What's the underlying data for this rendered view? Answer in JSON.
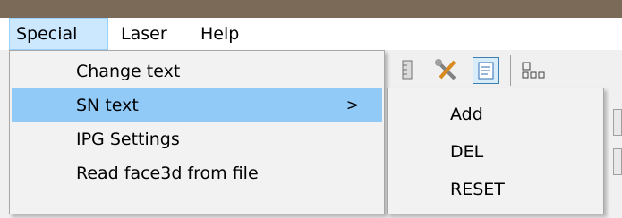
{
  "menubar": {
    "items": [
      {
        "label": "Special",
        "active": true
      },
      {
        "label": "Laser",
        "active": false
      },
      {
        "label": "Help",
        "active": false
      }
    ]
  },
  "toolbar": {
    "icons": [
      "ruler-icon",
      "tools-icon",
      "properties-icon",
      "layout-icon"
    ]
  },
  "special_menu": {
    "items": [
      {
        "label": "Change text"
      },
      {
        "label": "SN text",
        "has_submenu": true,
        "arrow": ">",
        "highlighted": true
      },
      {
        "label": "IPG Settings"
      },
      {
        "label": "Read face3d from file"
      }
    ]
  },
  "sn_text_submenu": {
    "items": [
      {
        "label": "Add"
      },
      {
        "label": "DEL"
      },
      {
        "label": "RESET"
      }
    ]
  },
  "colors": {
    "highlight": "#91c9f7",
    "menubar_active": "#cce8ff",
    "titlebar": "#7b6a58"
  }
}
